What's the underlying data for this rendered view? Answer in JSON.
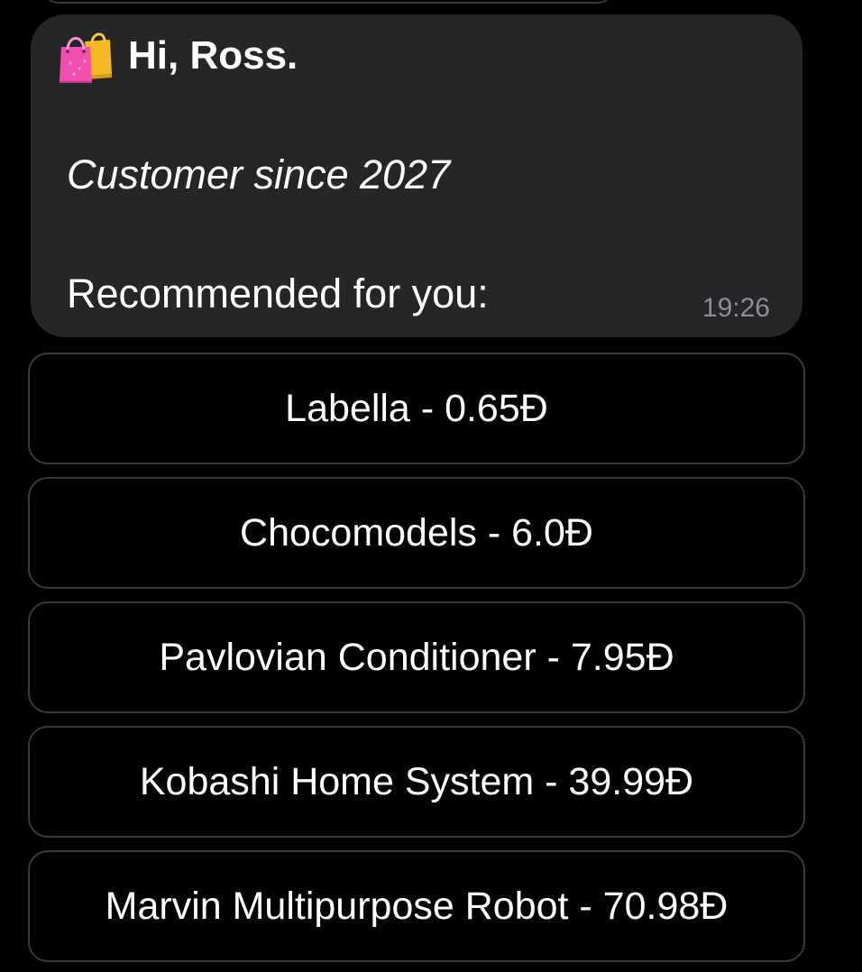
{
  "message": {
    "greeting": "Hi, Ross.",
    "greeting_icon": "shopping-bags-icon",
    "customer_since": "Customer since 2027",
    "recommended_label": "Recommended for you:",
    "time": "19:26"
  },
  "colors": {
    "background": "#000000",
    "bubble": "#262628",
    "button_border": "#3a3a3c",
    "time_text": "#8e8e93"
  },
  "buttons": [
    {
      "label": "Labella - 0.65Đ"
    },
    {
      "label": "Chocomodels - 6.0Đ"
    },
    {
      "label": "Pavlovian Conditioner - 7.95Đ"
    },
    {
      "label": "Kobashi Home System - 39.99Đ"
    },
    {
      "label": "Marvin Multipurpose Robot - 70.98Đ"
    }
  ]
}
